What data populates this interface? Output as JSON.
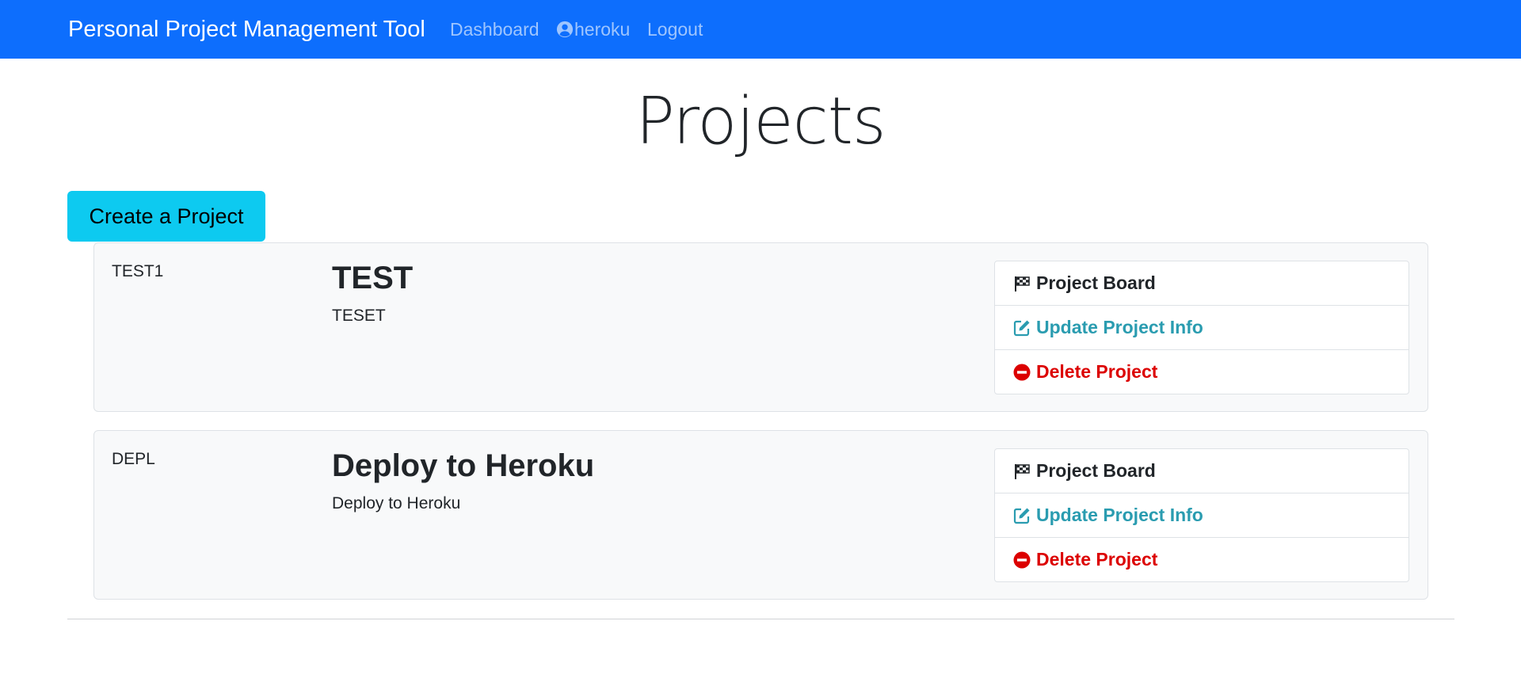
{
  "navbar": {
    "brand": "Personal Project Management Tool",
    "links": {
      "dashboard": "Dashboard",
      "user": "heroku",
      "logout": "Logout"
    },
    "colors": {
      "background": "#0d6efd"
    }
  },
  "main": {
    "title": "Projects",
    "create_button": "Create a Project"
  },
  "projects": [
    {
      "identifier": "TEST1",
      "name": "TEST",
      "description": "TESET",
      "actions": {
        "board": "Project Board",
        "update": "Update Project Info",
        "delete": "Delete Project"
      }
    },
    {
      "identifier": "DEPL",
      "name": "Deploy to Heroku",
      "description": "Deploy to Heroku",
      "actions": {
        "board": "Project Board",
        "update": "Update Project Info",
        "delete": "Delete Project"
      }
    }
  ],
  "icons": {
    "user": "user-circle-icon",
    "board": "flag-checkered-icon",
    "update": "edit-icon",
    "delete": "minus-circle-icon"
  }
}
